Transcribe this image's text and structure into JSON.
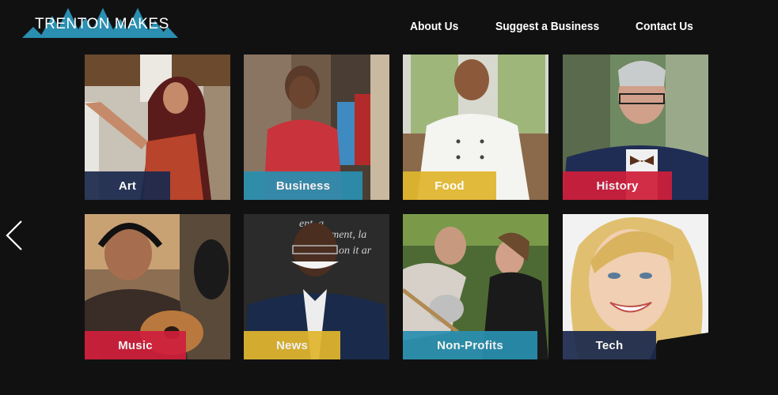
{
  "brand": {
    "name": "TRENTON MAKES",
    "colors": {
      "teal": "#2a8fb0",
      "darkblue": "#1c2a4e",
      "red": "#cf1f3b",
      "yellow": "#e1b62e",
      "background": "#111112"
    }
  },
  "nav": {
    "items": [
      {
        "label": "About Us"
      },
      {
        "label": "Suggest a Business"
      },
      {
        "label": "Contact Us"
      }
    ]
  },
  "carousel": {
    "prev_icon": "chevron-left-icon"
  },
  "categories": [
    {
      "label": "Art",
      "color": "#1c2a4e"
    },
    {
      "label": "Business",
      "color": "#2a8fb0"
    },
    {
      "label": "Food",
      "color": "#e1b62e"
    },
    {
      "label": "History",
      "color": "#cf1f3b"
    },
    {
      "label": "Music",
      "color": "#cf1f3b"
    },
    {
      "label": "News",
      "color": "#e1b62e"
    },
    {
      "label": "Non-Profits",
      "color": "#2a8fb0"
    },
    {
      "label": "Tech",
      "color": "#1c2a4e"
    }
  ]
}
